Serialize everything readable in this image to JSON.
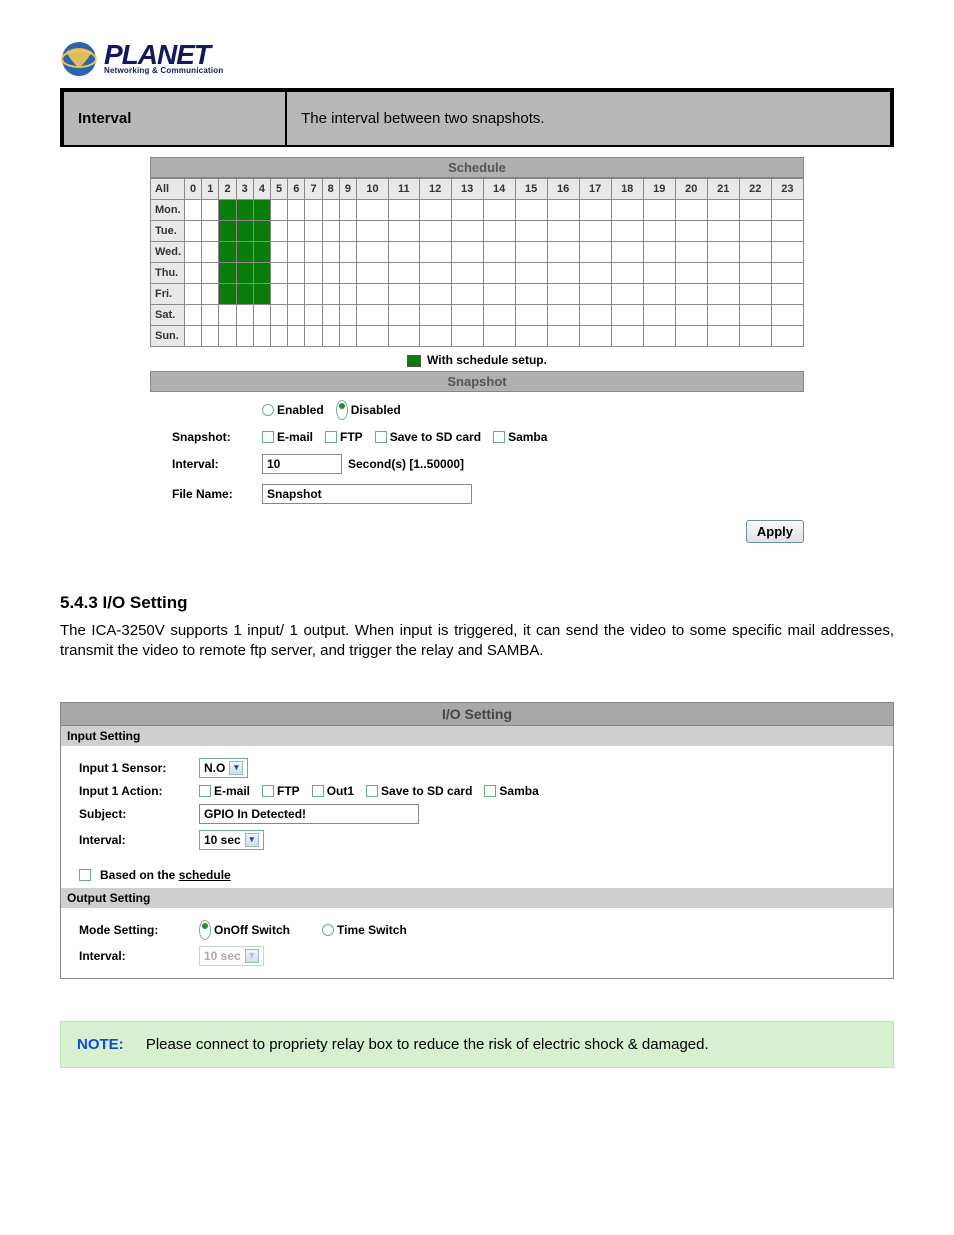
{
  "logo": {
    "brand": "PLANET",
    "tagline": "Networking & Communication"
  },
  "def": {
    "label": "Interval",
    "value": "The interval between two snapshots."
  },
  "schedule": {
    "title": "Schedule",
    "all": "All",
    "hours": [
      "0",
      "1",
      "2",
      "3",
      "4",
      "5",
      "6",
      "7",
      "8",
      "9",
      "10",
      "11",
      "12",
      "13",
      "14",
      "15",
      "16",
      "17",
      "18",
      "19",
      "20",
      "21",
      "22",
      "23"
    ],
    "days": [
      "Mon.",
      "Tue.",
      "Wed.",
      "Thu.",
      "Fri.",
      "Sat.",
      "Sun."
    ],
    "on_hours": [
      2,
      3,
      4
    ],
    "on_days": [
      0,
      1,
      2,
      3,
      4
    ],
    "legend": "With schedule setup."
  },
  "snapshot": {
    "title": "Snapshot",
    "enabled_label": "Enabled",
    "disabled_label": "Disabled",
    "selected": "disabled",
    "snap_label": "Snapshot:",
    "options": {
      "email": "E-mail",
      "ftp": "FTP",
      "sd": "Save to SD card",
      "samba": "Samba"
    },
    "interval_label": "Interval:",
    "interval_value": "10",
    "interval_hint": "Second(s) [1..50000]",
    "filename_label": "File Name:",
    "filename_value": "Snapshot",
    "apply": "Apply"
  },
  "section": {
    "heading": "5.4.3 I/O Setting",
    "text": "The ICA-3250V supports 1 input/ 1 output. When input is triggered, it can send the video to some specific mail addresses, transmit the video to remote ftp server, and trigger the relay and SAMBA."
  },
  "io": {
    "title": "I/O Setting",
    "input_hdr": "Input Setting",
    "input1_sensor_label": "Input 1 Sensor:",
    "input1_sensor_value": "N.O",
    "input1_action_label": "Input 1 Action:",
    "actions": {
      "email": "E-mail",
      "ftp": "FTP",
      "out1": "Out1",
      "sd": "Save to SD card",
      "samba": "Samba"
    },
    "subject_label": "Subject:",
    "subject_value": "GPIO In Detected!",
    "interval_label": "Interval:",
    "interval_value": "10 sec",
    "based_label_pre": "Based on the ",
    "based_label_link": "schedule",
    "output_hdr": "Output Setting",
    "mode_label": "Mode Setting:",
    "mode_onoff": "OnOff Switch",
    "mode_time": "Time Switch",
    "out_interval_label": "Interval:",
    "out_interval_value": "10 sec"
  },
  "note": {
    "label": "NOTE:",
    "text": "Please connect to propriety relay box to reduce the risk of electric shock & damaged."
  }
}
